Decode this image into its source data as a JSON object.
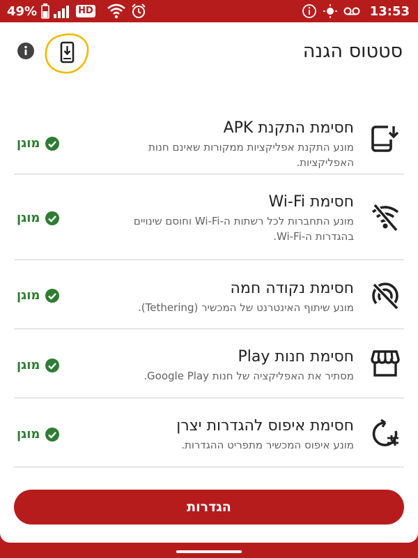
{
  "status_bar": {
    "battery_percent": "49%",
    "hd_badge": "HD",
    "time": "13:53"
  },
  "header": {
    "title": "סטטוס הגנה"
  },
  "protections": [
    {
      "title": "חסימת התקנת APK",
      "description": "מונע התקנת אפליקציות ממקורות שאינם חנות האפליקציות.",
      "status": "מוגן",
      "icon": "phone-download-icon"
    },
    {
      "title": "חסימת Wi-Fi",
      "description": "מונע התחברות לכל רשתות ה-Wi-Fi וחוסם שינויים בהגדרות ה-Wi-Fi.",
      "status": "מוגן",
      "icon": "wifi-off-icon"
    },
    {
      "title": "חסימת נקודה חמה",
      "description": "מונע שיתוף האינטרנט של המכשיר (Tethering).",
      "status": "מוגן",
      "icon": "hotspot-off-icon"
    },
    {
      "title": "חסימת חנות Play",
      "description": "מסתיר את האפליקציה של חנות Google Play.",
      "status": "מוגן",
      "icon": "storefront-icon"
    },
    {
      "title": "חסימת איפוס להגדרות יצרן",
      "description": "מונע איפוס המכשיר מתפריט ההגדרות.",
      "status": "מוגן",
      "icon": "reset-settings-icon"
    }
  ],
  "footer": {
    "settings_label": "הגדרות"
  },
  "colors": {
    "brand": "#b71c1c",
    "success": "#2e7d32",
    "highlight": "#f5b800"
  }
}
